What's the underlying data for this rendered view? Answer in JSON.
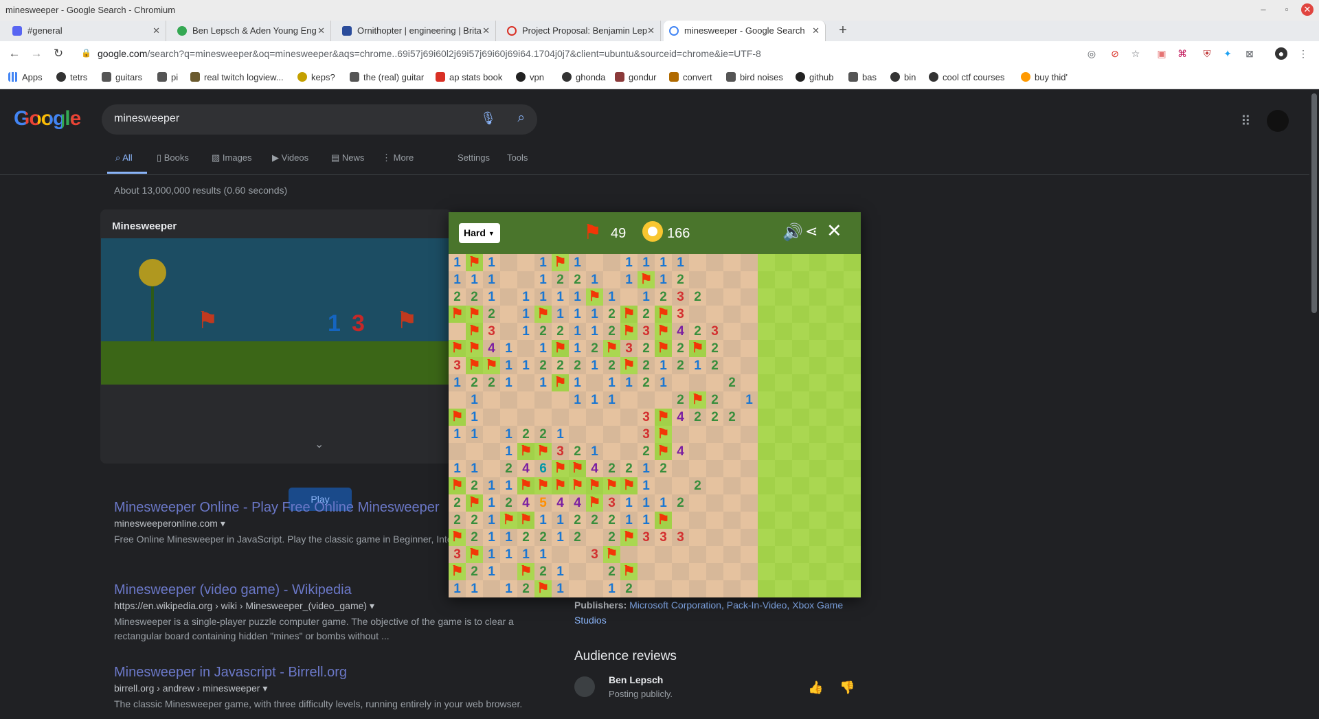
{
  "window": {
    "title": "minesweeper - Google Search - Chromium"
  },
  "tabs": [
    {
      "label": "#general",
      "color": "#5865f2"
    },
    {
      "label": "Ben Lepsch & Aden Young Eng",
      "color": "#34a853"
    },
    {
      "label": "Ornithopter | engineering | Brita",
      "color": "#2b4c9b"
    },
    {
      "label": "Project Proposal: Benjamin Lep",
      "color": "#d93025"
    },
    {
      "label": "minesweeper - Google Search",
      "color": "#4285f4"
    }
  ],
  "toolbar": {
    "url_host": "google.com",
    "url_path": "/search?q=minesweeper&oq=minesweeper&aqs=chrome..69i57j69i60l2j69i57j69i60j69i64.1704j0j7&client=ubuntu&sourceid=chrome&ie=UTF-8"
  },
  "bookmarks": [
    {
      "label": "Apps",
      "color": "#4285f4"
    },
    {
      "label": "tetrs",
      "color": "#333333"
    },
    {
      "label": "guitars",
      "color": "#555555"
    },
    {
      "label": "pi",
      "color": "#555555"
    },
    {
      "label": "real twitch logview...",
      "color": "#6b5b2f"
    },
    {
      "label": "keps?",
      "color": "#c4a000"
    },
    {
      "label": "the (real) guitar",
      "color": "#555555"
    },
    {
      "label": "ap stats book",
      "color": "#d93025"
    },
    {
      "label": "vpn",
      "color": "#222222"
    },
    {
      "label": "ghonda",
      "color": "#333333"
    },
    {
      "label": "gondur",
      "color": "#8b3a3a"
    },
    {
      "label": "convert",
      "color": "#b06a00"
    },
    {
      "label": "bird noises",
      "color": "#555555"
    },
    {
      "label": "github",
      "color": "#222222"
    },
    {
      "label": "bas",
      "color": "#555555"
    },
    {
      "label": "bin",
      "color": "#333333"
    },
    {
      "label": "cool ctf courses",
      "color": "#333333"
    },
    {
      "label": "buy thid'",
      "color": "#ff9900"
    }
  ],
  "google": {
    "logo": "Google",
    "query": "minesweeper",
    "tabs": [
      "All",
      "Books",
      "Images",
      "Videos",
      "News",
      "More",
      "Settings",
      "Tools"
    ],
    "stats": "About 13,000,000 results (0.60 seconds)",
    "panel_title": "Minesweeper",
    "play_label": "Play",
    "results": [
      {
        "title": "Minesweeper Online - Play Free Online Minesweeper",
        "url": "minesweeperonline.com",
        "snippet": "Free Online Minesweeper in JavaScript. Play the classic game in Beginner, Inte... Expert modes."
      },
      {
        "title": "Minesweeper (video game) - Wikipedia",
        "url": "https://en.wikipedia.org › wiki › Minesweeper_(video_game)",
        "snippet": "Minesweeper is a single-player puzzle computer game. The objective of the game is to clear a rectangular board containing hidden \"mines\" or bombs without ..."
      },
      {
        "title": "Minesweeper in Javascript - Birrell.org",
        "url": "birrell.org › andrew › minesweeper",
        "snippet": "The classic Minesweeper game, with three difficulty levels, running entirely in your web browser."
      }
    ],
    "publishers_label": "Publishers:",
    "publishers": "Microsoft Corporation, Pack-In-Video, Xbox Game Studios",
    "audience_title": "Audience reviews",
    "reviewer": "Ben Lepsch",
    "reviewer_sub": "Posting publicly."
  },
  "game": {
    "difficulty": "Hard",
    "flags": "49",
    "time": "166",
    "board": [
      "1F1..1F1..1111....",
      "111..1221.1F12....",
      "221.1111F1.1232...",
      "FF2.1F1112F2F3....",
      ".F3.122112F3F423..",
      "FF41.1F12F32F2F2..",
      "3FF1122212F21212..",
      "1221.1F1.1121...2.",
      ".1.....111...2F2.1",
      "F1.........3F4222.",
      "11.1221....3F.....",
      "...1FF321..2F4....",
      "11.246FF42212.....",
      "F211FFFFFFF1..2...",
      "2F124544F31112....",
      "221FF1122211F.....",
      "F2112212.2F333....",
      "3F1111..3F........",
      "F21.F21..2F.......",
      "11.12F1..12......."
    ],
    "colors": {
      "1": "#1976d2",
      "2": "#388e3c",
      "3": "#d32f2f",
      "4": "#7b1fa2",
      "5": "#ff8f00",
      "6": "#0097a7",
      "flag": "#f23607"
    }
  }
}
